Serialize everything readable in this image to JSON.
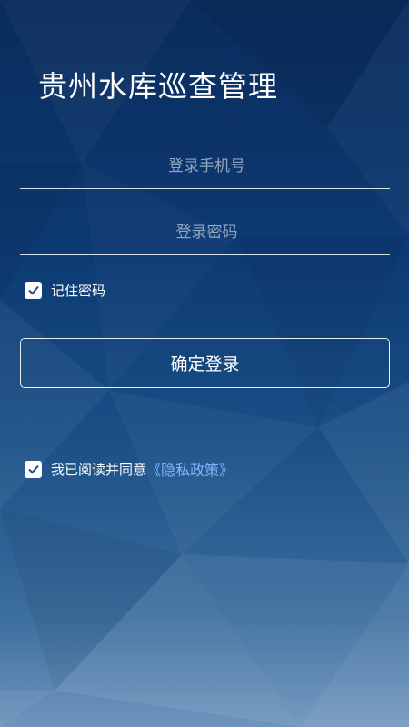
{
  "app": {
    "title": "贵州水库巡查管理"
  },
  "form": {
    "phone_placeholder": "登录手机号",
    "password_placeholder": "登录密码",
    "remember_label": "记住密码",
    "remember_checked": true,
    "login_button": "确定登录"
  },
  "agreement": {
    "checked": true,
    "text": "我已阅读并同意",
    "policy_link": "《隐私政策》"
  },
  "colors": {
    "background_top": "#0a2c5c",
    "background_bottom": "#6f95bd",
    "link": "#7db6ff",
    "checkbox_check": "#1c4f8c"
  }
}
